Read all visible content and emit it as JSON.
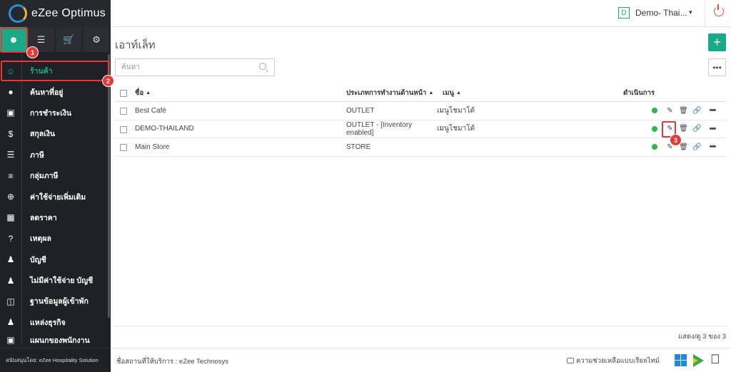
{
  "app": {
    "title": "eZee Optimus"
  },
  "header": {
    "property_initial": "D",
    "property_name": "Demo- Thai...",
    "caret": "▾"
  },
  "sidebar": {
    "items": [
      {
        "label": "ร้านค้า",
        "icon": "user-icon"
      },
      {
        "label": "ค้นหาที่อยู่",
        "icon": "location-icon"
      },
      {
        "label": "การชำระเงิน",
        "icon": "card-icon"
      },
      {
        "label": "สกุลเงิน",
        "icon": "dollar-icon"
      },
      {
        "label": "ภาษี",
        "icon": "bars-icon"
      },
      {
        "label": "กลุ่มภาษี",
        "icon": "list-icon"
      },
      {
        "label": "ค่าใช้จ่ายเพิ่มเติม",
        "icon": "plus-circle-icon"
      },
      {
        "label": "ลดราคา",
        "icon": "gift-icon"
      },
      {
        "label": "เหตุผล",
        "icon": "question-icon"
      },
      {
        "label": "บัญชี",
        "icon": "person-icon"
      },
      {
        "label": "ไม่มีค่าใช้จ่าย บัญชี",
        "icon": "person-icon"
      },
      {
        "label": "ฐานข้อมูลผู้เข้าพัก",
        "icon": "database-icon"
      },
      {
        "label": "แหล่งธุรกิจ",
        "icon": "users-icon"
      },
      {
        "label": "แผนกของพนักงาน",
        "icon": "card-icon"
      }
    ],
    "footer": "สนับสนุนโดย: eZee Hospitality Solution"
  },
  "annotations": {
    "b1": "1",
    "b2": "2",
    "b3": "3"
  },
  "main": {
    "title": "เอาท์เล็ท",
    "add_label": "+",
    "more_label": "•••",
    "search_placeholder": "ค้นหา",
    "columns": {
      "name": "ชื่อ",
      "type": "ประเภทการทำงานด้านหน้า",
      "menu": "เมนู",
      "actions": "ดำเนินการ",
      "sort": "▲"
    },
    "rows": [
      {
        "name": "Best Café",
        "type": "OUTLET",
        "menu": "เมนูโชมาโต้"
      },
      {
        "name": "DEMO-THAILAND",
        "type": "OUTLET - [Inventory enabled]",
        "menu": "เมนูโชมาโต้"
      },
      {
        "name": "Main Store",
        "type": "STORE",
        "menu": ""
      }
    ],
    "pager": "แสดง/ดู 3 ของ 3"
  },
  "footer": {
    "text": "ชื่อสถานที่ให้บริการ : eZee Technosys",
    "help": "ความช่วยเหลือแบบเรียลไทม์"
  },
  "colors": {
    "accent": "#1aaa8a",
    "sidebar": "#1f2126",
    "highlight": "#e53935",
    "status_on": "#2db84b"
  }
}
